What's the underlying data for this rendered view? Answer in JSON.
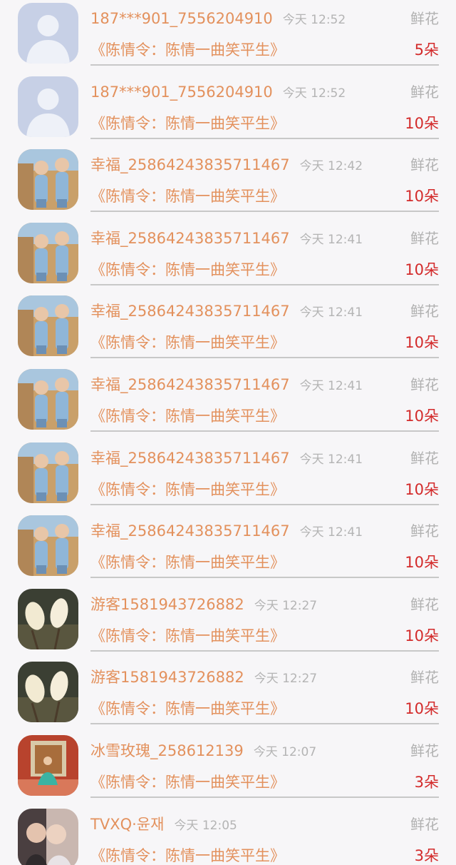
{
  "items": [
    {
      "user": "187***901_7556204910",
      "time": "今天 12:52",
      "gift": "鲜花",
      "program": "《陈情令：陈情一曲笑平生》",
      "count": "5朵",
      "avatar": "default-avatar-icon"
    },
    {
      "user": "187***901_7556204910",
      "time": "今天 12:52",
      "gift": "鲜花",
      "program": "《陈情令：陈情一曲笑平生》",
      "count": "10朵",
      "avatar": "default-avatar-icon"
    },
    {
      "user": "幸福_2586424383571146​7",
      "time": "今天 12:42",
      "gift": "鲜花",
      "program": "《陈情令：陈情一曲笑平生》",
      "count": "10朵",
      "avatar": "twins-photo-avatar"
    },
    {
      "user": "幸福_25864243835711467",
      "time": "今天 12:41",
      "gift": "鲜花",
      "program": "《陈情令：陈情一曲笑平生》",
      "count": "10朵",
      "avatar": "twins-photo-avatar"
    },
    {
      "user": "幸福_25864243835711467",
      "time": "今天 12:41",
      "gift": "鲜花",
      "program": "《陈情令：陈情一曲笑平生》",
      "count": "10朵",
      "avatar": "twins-photo-avatar"
    },
    {
      "user": "幸福_25864243835711467",
      "time": "今天 12:41",
      "gift": "鲜花",
      "program": "《陈情令：陈情一曲笑平生》",
      "count": "10朵",
      "avatar": "twins-photo-avatar"
    },
    {
      "user": "幸福_25864243835711467",
      "time": "今天 12:41",
      "gift": "鲜花",
      "program": "《陈情令：陈情一曲笑平生》",
      "count": "10朵",
      "avatar": "twins-photo-avatar"
    },
    {
      "user": "幸福_25864243835711467",
      "time": "今天 12:41",
      "gift": "鲜花",
      "program": "《陈情令：陈情一曲笑平生》",
      "count": "10朵",
      "avatar": "twins-photo-avatar"
    },
    {
      "user": "游客1581943726882",
      "time": "今天 12:27",
      "gift": "鲜花",
      "program": "《陈情令：陈情一曲笑平生》",
      "count": "10朵",
      "avatar": "magnolia-photo-avatar"
    },
    {
      "user": "游客1581943726882",
      "time": "今天 12:27",
      "gift": "鲜花",
      "program": "《陈情令：陈情一曲笑平生》",
      "count": "10朵",
      "avatar": "magnolia-photo-avatar"
    },
    {
      "user": "冰雪玫瑰_258612139",
      "time": "今天 12:07",
      "gift": "鲜花",
      "program": "《陈情令：陈情一曲笑平生》",
      "count": "3朵",
      "avatar": "girl-photo-avatar"
    },
    {
      "user": "TVXQ·윤재",
      "time": "今天 12:05",
      "gift": "鲜花",
      "program": "《陈情令：陈情一曲笑平生》",
      "count": "3朵",
      "avatar": "couple-photo-avatar"
    }
  ],
  "colors": {
    "username": "#e3915d",
    "program": "#e3915d",
    "count": "#d32b2b",
    "muted": "#b4b4b4",
    "background": "#f7f6f8"
  }
}
